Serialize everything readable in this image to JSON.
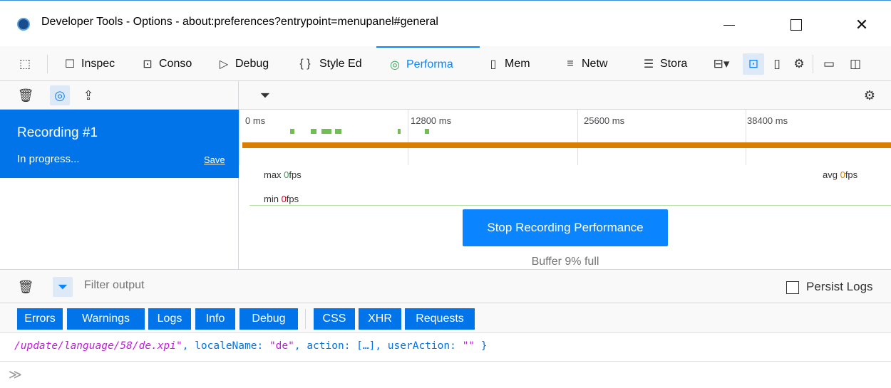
{
  "window": {
    "title": "Developer Tools - Options - about:preferences?entrypoint=menupanel#general",
    "minimize": "—",
    "close": "✕"
  },
  "toolbar": {
    "tabs": [
      {
        "label": "Inspec",
        "icon": "inspector-icon"
      },
      {
        "label": "Conso",
        "icon": "console-icon"
      },
      {
        "label": "Debug",
        "icon": "debugger-icon"
      },
      {
        "label": "Style Ed",
        "icon": "style-editor-icon"
      },
      {
        "label": "Performa",
        "icon": "performance-icon"
      },
      {
        "label": "Mem",
        "icon": "memory-icon"
      },
      {
        "label": "Netw",
        "icon": "network-icon"
      },
      {
        "label": "Stora",
        "icon": "storage-icon"
      }
    ],
    "selected_tab": "Performa"
  },
  "recordings": {
    "title": "Recording #1",
    "status": "In progress...",
    "save_label": "Save"
  },
  "timeline": {
    "ticks": [
      "0 ms",
      "12800 ms",
      "25600 ms",
      "38400 ms"
    ],
    "fps_max_prefix": "max ",
    "fps_max_value": "0",
    "fps_min_prefix": "min ",
    "fps_min_value": "0",
    "fps_avg_prefix": "avg ",
    "fps_avg_value": "0",
    "fps_unit": "fps",
    "stop_button": "Stop Recording Performance",
    "buffer_text": "Buffer 9% full"
  },
  "console": {
    "filter_placeholder": "Filter output",
    "persist_logs": "Persist Logs",
    "filters": [
      "Errors",
      "Warnings",
      "Logs",
      "Info",
      "Debug",
      "CSS",
      "XHR",
      "Requests"
    ],
    "output": {
      "str_path": "/update/language/58/de.xpi",
      "str_quote": "\"",
      "mid1": ", localeName: ",
      "locale": "\"de\"",
      "mid2": ", action: […], userAction: ",
      "user_action": "\"\"",
      "end": " }"
    },
    "prompt": "≫"
  }
}
